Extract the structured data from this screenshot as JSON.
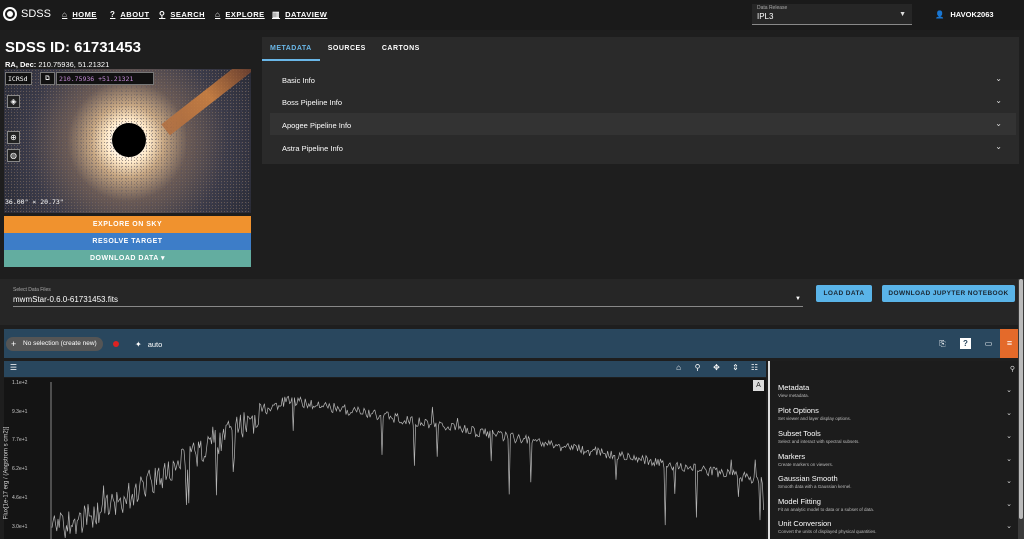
{
  "nav": {
    "brand": "SDSS",
    "items": [
      {
        "label": "HOME",
        "icon": "home-icon"
      },
      {
        "label": "ABOUT",
        "icon": "help-icon"
      },
      {
        "label": "SEARCH",
        "icon": "search-icon"
      },
      {
        "label": "EXPLORE",
        "icon": "explore-icon"
      },
      {
        "label": "DATAVIEW",
        "icon": "chart-icon"
      }
    ],
    "release_label": "Data Release",
    "release_value": "IPL3",
    "user": "HAVOK2063"
  },
  "target": {
    "title": "SDSS ID: 61731453",
    "radec_label": "RA, Dec:",
    "radec_value": "210.75936, 51.21321"
  },
  "sky": {
    "frame": "ICRSd",
    "coords": "210.75936 +51.21321",
    "fov": "36.00\" × 20.73\""
  },
  "actions": {
    "explore": "EXPLORE ON SKY",
    "resolve": "RESOLVE TARGET",
    "download": "DOWNLOAD DATA ▾"
  },
  "tabs": [
    "METADATA",
    "SOURCES",
    "CARTONS"
  ],
  "accordion": [
    "Basic Info",
    "Boss Pipeline Info",
    "Apogee Pipeline Info",
    "Astra Pipeline Info"
  ],
  "files": {
    "label": "Select Data Files",
    "value": "mwmStar-0.6.0-61731453.fits",
    "load": "LOAD DATA",
    "notebook": "DOWNLOAD JUPYTER NOTEBOOK"
  },
  "toolbar": {
    "selection": "No selection (create new)",
    "mode": "auto"
  },
  "plot": {
    "y_ticks": [
      "1.1e+2",
      "9.3e+1",
      "7.7e+1",
      "6.2e+1",
      "4.6e+1",
      "3.0e+1"
    ],
    "y_label": "Flux[1e-17 erg / (Angstrom s cm2)]",
    "a_button": "A"
  },
  "plugins": [
    {
      "title": "Metadata",
      "desc": "View metadata."
    },
    {
      "title": "Plot Options",
      "desc": "Set viewer and layer display options."
    },
    {
      "title": "Subset Tools",
      "desc": "Select and interact with spectral subsets."
    },
    {
      "title": "Markers",
      "desc": "Create markers on viewers."
    },
    {
      "title": "Gaussian Smooth",
      "desc": "Smooth data with a Gaussian kernel."
    },
    {
      "title": "Model Fitting",
      "desc": "Fit an analytic model to data or a subset of data."
    },
    {
      "title": "Unit Conversion",
      "desc": "Convert the units of displayed physical quantities."
    }
  ],
  "colors": {
    "explore": "#f0922e",
    "resolve": "#3d7dc8",
    "download": "#63ada0",
    "accent": "#6ab7e8"
  }
}
